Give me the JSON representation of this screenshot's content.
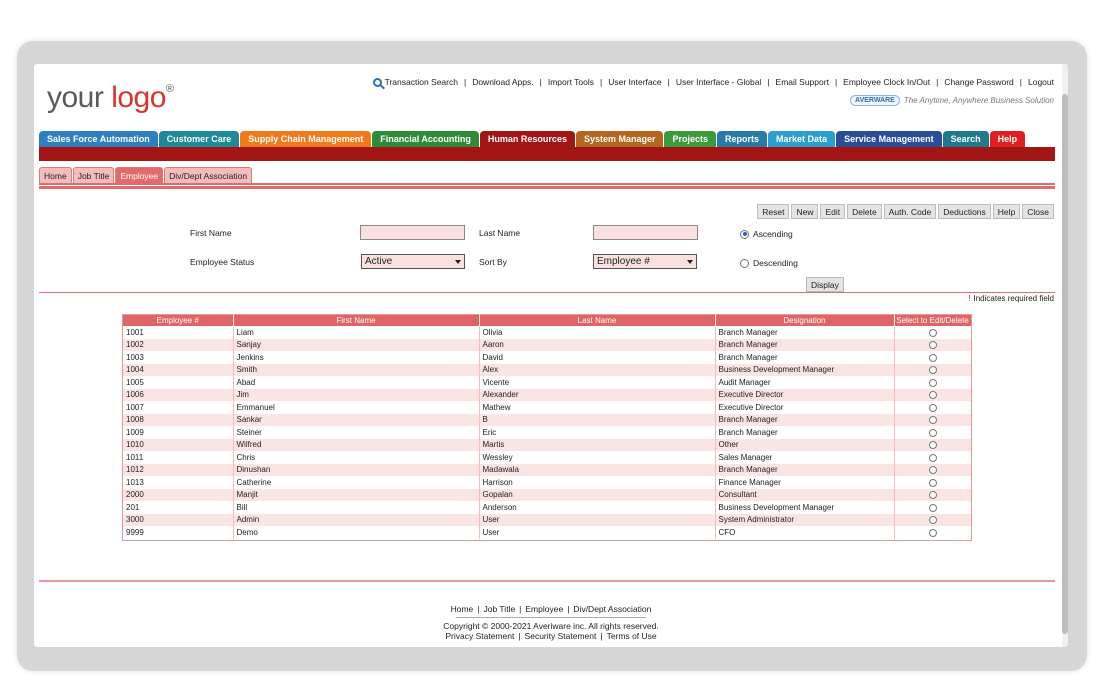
{
  "logo": {
    "part1": "your",
    "part2": "logo",
    "mark": "®"
  },
  "toplinks": [
    {
      "label": "Transaction Search",
      "icon": "search-icon"
    },
    {
      "label": "Download Apps."
    },
    {
      "label": "Import Tools"
    },
    {
      "label": "User Interface"
    },
    {
      "label": "User Interface - Global"
    },
    {
      "label": "Email Support"
    },
    {
      "label": "Employee Clock In/Out"
    },
    {
      "label": "Change Password"
    },
    {
      "label": "Logout"
    }
  ],
  "brand": {
    "badge": "AVERWARE",
    "tagline": "The Anytime, Anywhere Business Solution"
  },
  "modules": [
    {
      "label": "Sales Force Automation",
      "color": "#2f7fc0"
    },
    {
      "label": "Customer Care",
      "color": "#1d8a9a"
    },
    {
      "label": "Supply Chain Management",
      "color": "#f07a1a"
    },
    {
      "label": "Financial Accounting",
      "color": "#2e8b3a"
    },
    {
      "label": "Human Resources",
      "color": "#a31515"
    },
    {
      "label": "System Manager",
      "color": "#b5651d"
    },
    {
      "label": "Projects",
      "color": "#3c9a3c"
    },
    {
      "label": "Reports",
      "color": "#2a7aa8"
    },
    {
      "label": "Market Data",
      "color": "#2aa0d0"
    },
    {
      "label": "Service Management",
      "color": "#2a4d9a"
    },
    {
      "label": "Search",
      "color": "#1f7a8a"
    },
    {
      "label": "Help",
      "color": "#e02020"
    }
  ],
  "subtabs": [
    "Home",
    "Job Title",
    "Employee",
    "Div/Dept Association"
  ],
  "active_subtab": "Employee",
  "actions": [
    "Reset",
    "New",
    "Edit",
    "Delete",
    "Auth. Code",
    "Deductions",
    "Help",
    "Close"
  ],
  "form": {
    "first_name_label": "First Name",
    "first_name_value": "",
    "last_name_label": "Last Name",
    "last_name_value": "",
    "status_label": "Employee Status",
    "status_value": "Active",
    "sort_label": "Sort By",
    "sort_value": "Employee #",
    "ascending_label": "Ascending",
    "descending_label": "Descending",
    "order_selected": "Ascending",
    "display_button": "Display",
    "required_note": "Indicates required field",
    "required_mark": "!"
  },
  "table": {
    "headers": [
      "Employee #",
      "First Name",
      "Last Name",
      "Designation",
      "Select to Edit/Delete"
    ],
    "rows": [
      [
        "1001",
        "Liam",
        "Olivia",
        "Branch Manager"
      ],
      [
        "1002",
        "Sanjay",
        "Aaron",
        "Branch Manager"
      ],
      [
        "1003",
        "Jenkins",
        "David",
        "Branch Manager"
      ],
      [
        "1004",
        "Smith",
        "Alex",
        "Business Development Manager"
      ],
      [
        "1005",
        "Abad",
        "Vicente",
        "Audit Manager"
      ],
      [
        "1006",
        "Jim",
        "Alexander",
        "Executive Director"
      ],
      [
        "1007",
        "Emmanuel",
        "Mathew",
        "Executive Director"
      ],
      [
        "1008",
        "Sankar",
        "B",
        "Branch Manager"
      ],
      [
        "1009",
        "Steiner",
        "Eric",
        "Branch Manager"
      ],
      [
        "1010",
        "Wilfred",
        "Martis",
        "Other"
      ],
      [
        "1011",
        "Chris",
        "Wessley",
        "Sales Manager"
      ],
      [
        "1012",
        "Dinushan",
        "Madawala",
        "Branch Manager"
      ],
      [
        "1013",
        "Catherine",
        "Harrison",
        "Finance Manager"
      ],
      [
        "2000",
        "Manjit",
        "Gopalan",
        "Consultant"
      ],
      [
        "201",
        "Bill",
        "Anderson",
        "Business Development Manager"
      ],
      [
        "3000",
        "Admin",
        "User",
        "System Administrator"
      ],
      [
        "9999",
        "Demo",
        "User",
        "CFO"
      ]
    ]
  },
  "footer": {
    "links": [
      "Home",
      "Job Title",
      "Employee",
      "Div/Dept Association"
    ],
    "copyright": "Copyright © 2000-2021 Averiware inc. All rights reserved.",
    "legal": [
      "Privacy Statement",
      "Security Statement",
      "Terms of Use"
    ]
  }
}
